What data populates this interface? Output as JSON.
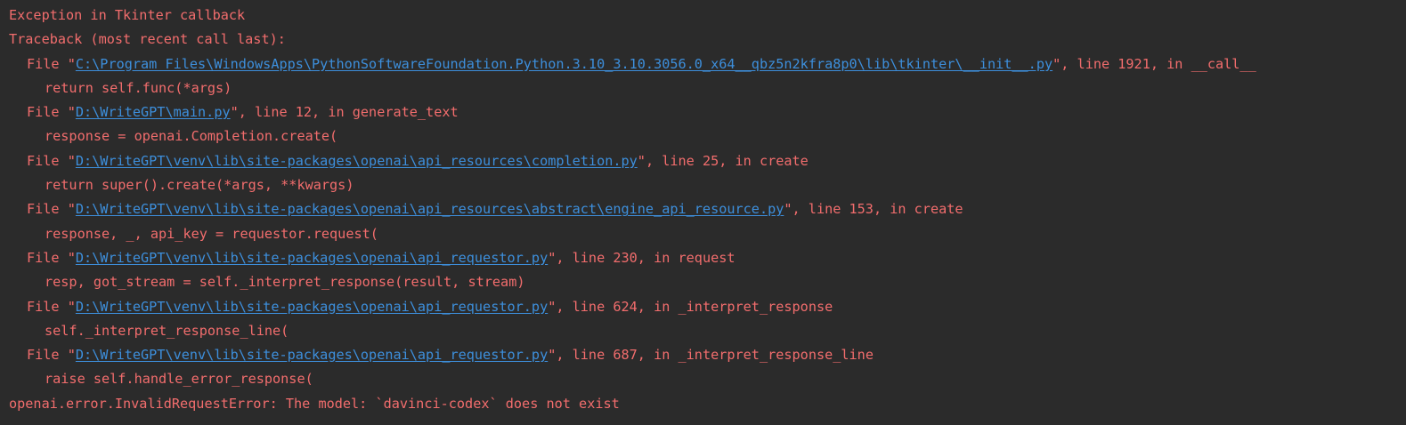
{
  "console": {
    "lines": {
      "l0": {
        "text": "Exception in Tkinter callback"
      },
      "l1": {
        "text": "Traceback (most recent call last):"
      },
      "l2": {
        "prefix": "File \"",
        "path": "C:\\Program Files\\WindowsApps\\PythonSoftwareFoundation.Python.3.10_3.10.3056.0_x64__qbz5n2kfra8p0\\lib\\tkinter\\__init__.py",
        "suffix": "\", line 1921, in __call__"
      },
      "l3": {
        "text": "return self.func(*args)"
      },
      "l4": {
        "prefix": "File \"",
        "path": "D:\\WriteGPT\\main.py",
        "suffix": "\", line 12, in generate_text"
      },
      "l5": {
        "text": "response = openai.Completion.create("
      },
      "l6": {
        "prefix": "File \"",
        "path": "D:\\WriteGPT\\venv\\lib\\site-packages\\openai\\api_resources\\completion.py",
        "suffix": "\", line 25, in create"
      },
      "l7": {
        "text": "return super().create(*args, **kwargs)"
      },
      "l8": {
        "prefix": "File \"",
        "path": "D:\\WriteGPT\\venv\\lib\\site-packages\\openai\\api_resources\\abstract\\engine_api_resource.py",
        "suffix": "\", line 153, in create"
      },
      "l9": {
        "text": "response, _, api_key = requestor.request("
      },
      "l10": {
        "prefix": "File \"",
        "path": "D:\\WriteGPT\\venv\\lib\\site-packages\\openai\\api_requestor.py",
        "suffix": "\", line 230, in request"
      },
      "l11": {
        "text": "resp, got_stream = self._interpret_response(result, stream)"
      },
      "l12": {
        "prefix": "File \"",
        "path": "D:\\WriteGPT\\venv\\lib\\site-packages\\openai\\api_requestor.py",
        "suffix": "\", line 624, in _interpret_response"
      },
      "l13": {
        "text": "self._interpret_response_line("
      },
      "l14": {
        "prefix": "File \"",
        "path": "D:\\WriteGPT\\venv\\lib\\site-packages\\openai\\api_requestor.py",
        "suffix": "\", line 687, in _interpret_response_line"
      },
      "l15": {
        "text": "raise self.handle_error_response("
      },
      "l16": {
        "text": "openai.error.InvalidRequestError: The model: `davinci-codex` does not exist"
      }
    }
  },
  "colors": {
    "background": "#2b2b2b",
    "error_text": "#f26d6d",
    "link": "#3d8fdc"
  }
}
